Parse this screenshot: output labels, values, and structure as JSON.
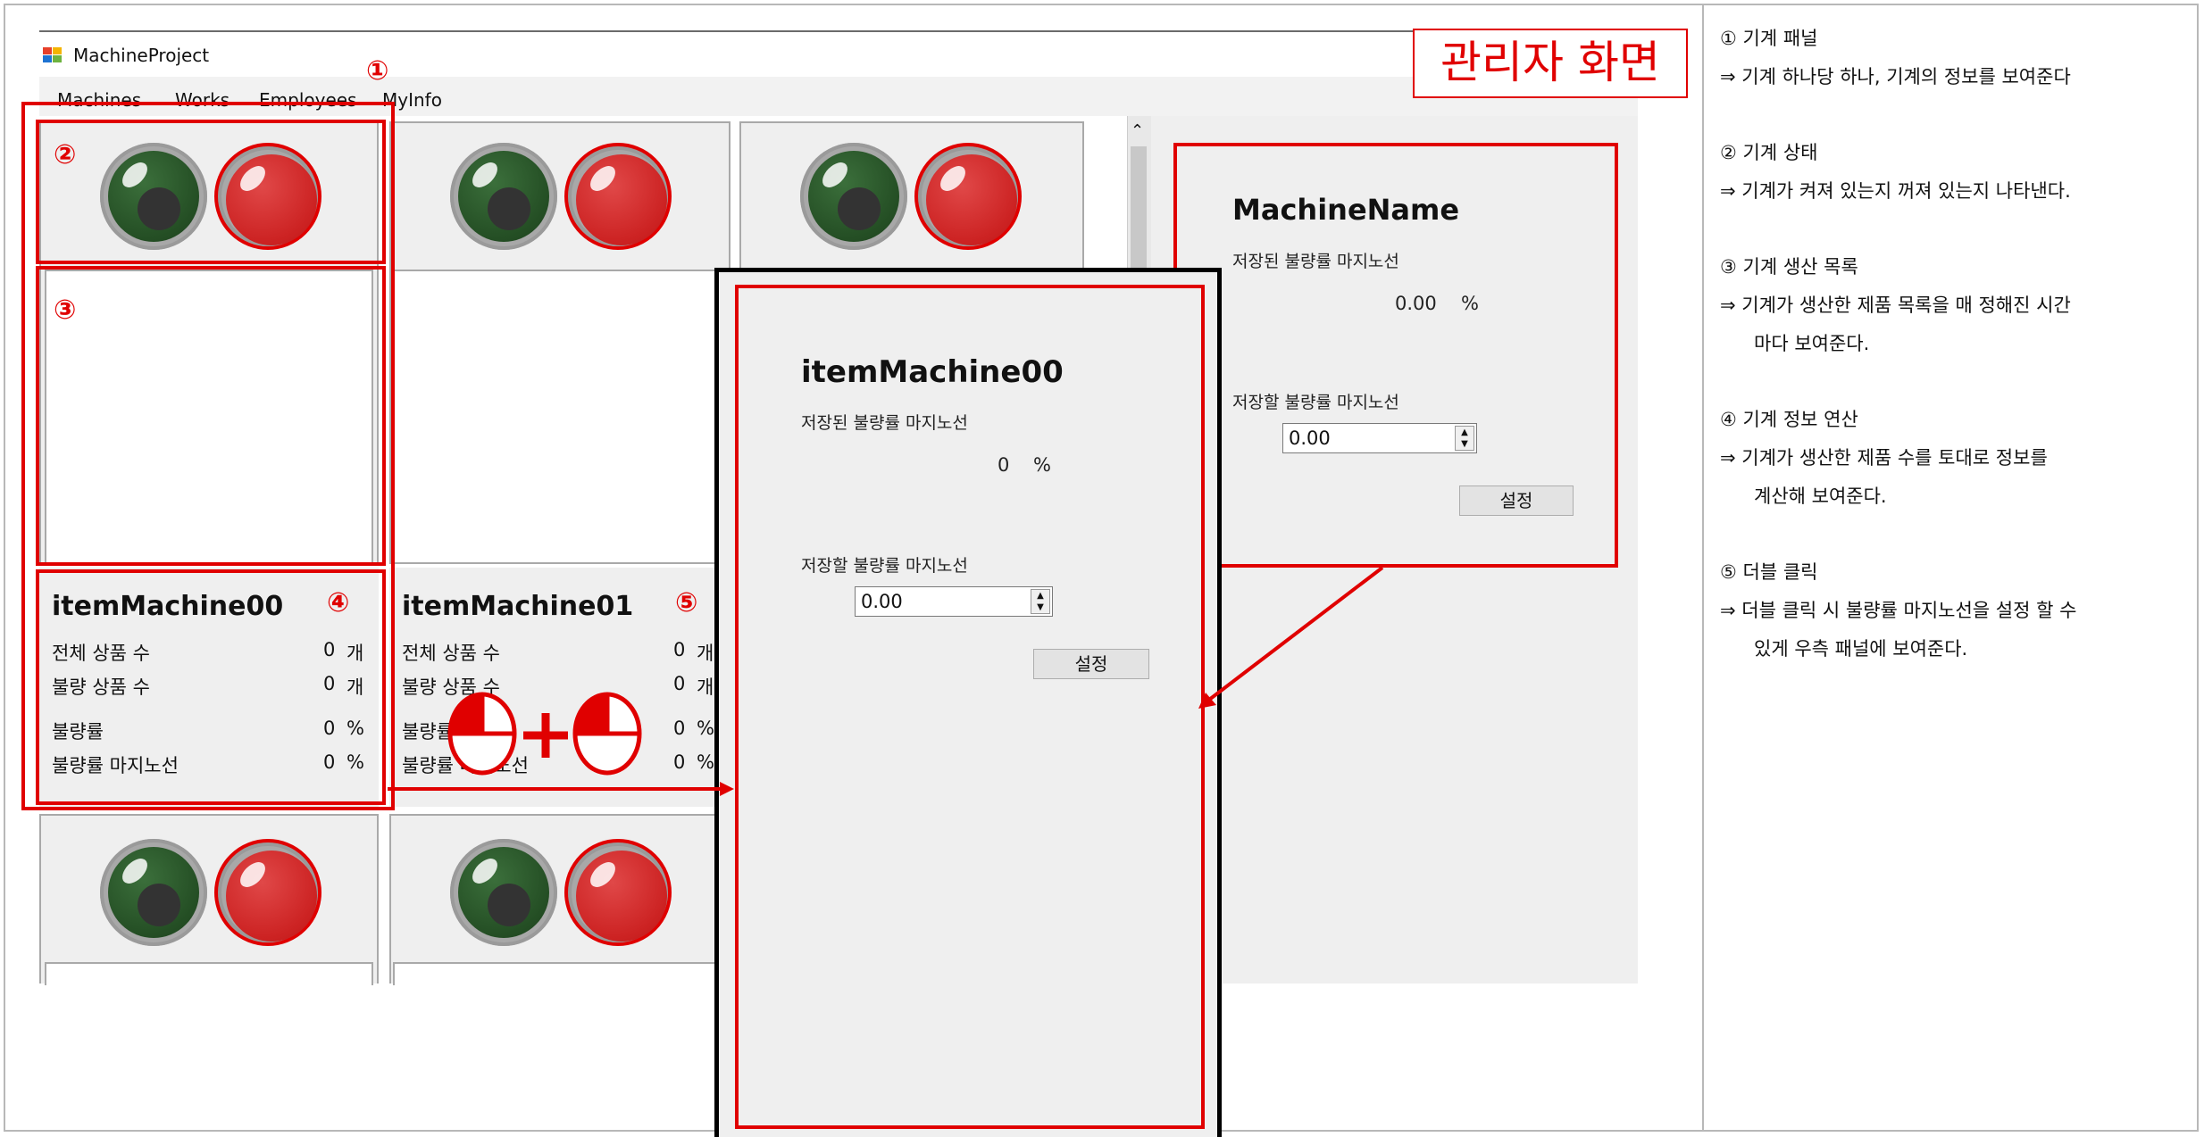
{
  "window": {
    "title": "MachineProject"
  },
  "menu": [
    "Machines",
    "Works",
    "Employees",
    "MyInfo"
  ],
  "admin_label": "관리자 화면",
  "machines": [
    {
      "name": "itemMachine00",
      "rows": [
        {
          "label": "전체 상품 수",
          "value": "0",
          "unit": "개"
        },
        {
          "label": "불량 상품 수",
          "value": "0",
          "unit": "개"
        },
        {
          "label": "불량률",
          "value": "0",
          "unit": "%"
        },
        {
          "label": "불량률 마지노선",
          "value": "0",
          "unit": "%"
        }
      ]
    },
    {
      "name": "itemMachine01",
      "rows": [
        {
          "label": "전체 상품 수",
          "value": "0",
          "unit": "개"
        },
        {
          "label": "불량 상품 수",
          "value": "0",
          "unit": "개"
        },
        {
          "label": "불량률",
          "value": "0",
          "unit": "%"
        },
        {
          "label": "불량률 마지노선",
          "value": "0",
          "unit": "%"
        }
      ]
    }
  ],
  "popup": {
    "name": "itemMachine00",
    "saved_label": "저장된 불량률 마지노선",
    "saved_value": "0",
    "saved_unit": "%",
    "set_label": "저장할 불량률 마지노선",
    "input_value": "0.00",
    "button": "설정"
  },
  "side_panel": {
    "name": "MachineName",
    "saved_label": "저장된 불량률 마지노선",
    "saved_value": "0.00",
    "saved_unit": "%",
    "set_label": "저장할 불량률 마지노선",
    "input_value": "0.00",
    "button": "설정"
  },
  "markers": [
    "①",
    "②",
    "③",
    "④",
    "⑤"
  ],
  "notes": [
    {
      "title": "① 기계 패널",
      "lines": [
        "⇒ 기계 하나당 하나, 기계의 정보를 보여준다"
      ]
    },
    {
      "title": "② 기계 상태",
      "lines": [
        "⇒ 기계가 켜져 있는지 꺼져 있는지 나타낸다."
      ]
    },
    {
      "title": "③ 기계 생산 목록",
      "lines": [
        "⇒ 기계가 생산한 제품 목록을 매 정해진 시간",
        "마다 보여준다."
      ]
    },
    {
      "title": "④ 기계 정보 연산",
      "lines": [
        "⇒ 기계가 생산한 제품 수를 토대로 정보를",
        "계산해 보여준다."
      ]
    },
    {
      "title": "⑤ 더블 클릭",
      "lines": [
        "⇒ 더블 클릭 시 불량률 마지노선을 설정 할 수",
        "있게 우측 패널에 보여준다."
      ]
    }
  ],
  "colors": {
    "annotation_red": "#e00000",
    "lamp_green": "#2c5a2c",
    "lamp_red": "#cc2222",
    "panel_bg": "#efefef"
  },
  "icons": [
    "app-icon",
    "scroll-up-arrow-icon",
    "mouse-icon",
    "spinner-arrows-icon",
    "arrow-icon"
  ]
}
